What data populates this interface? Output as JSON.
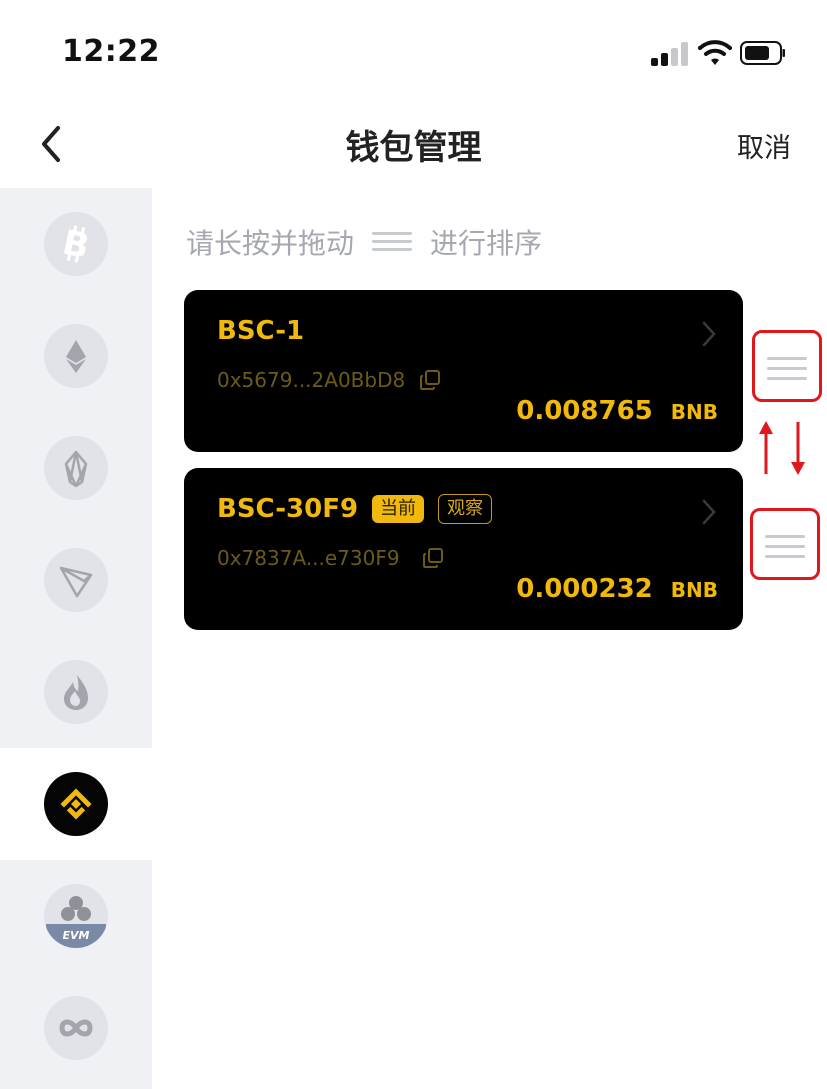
{
  "status_bar": {
    "time": "12:22"
  },
  "header": {
    "title": "钱包管理",
    "cancel_label": "取消"
  },
  "sidebar": {
    "items": [
      {
        "name": "bitcoin",
        "icon": "bitcoin-icon",
        "active": false
      },
      {
        "name": "ethereum",
        "icon": "ethereum-icon",
        "active": false
      },
      {
        "name": "eos",
        "icon": "eos-icon",
        "active": false
      },
      {
        "name": "tron",
        "icon": "tron-icon",
        "active": false
      },
      {
        "name": "heco",
        "icon": "flame-icon",
        "active": false
      },
      {
        "name": "bsc",
        "icon": "binance-icon",
        "active": true
      },
      {
        "name": "evm",
        "icon": "evm-icon",
        "label": "EVM",
        "active": false
      },
      {
        "name": "infinity",
        "icon": "infinity-icon",
        "active": false
      }
    ]
  },
  "hint": {
    "before": "请长按并拖动",
    "after": "进行排序"
  },
  "wallets": [
    {
      "name": "BSC-1",
      "address": "0x5679...2A0BbD8",
      "amount": "0.008765",
      "unit": "BNB",
      "badges": []
    },
    {
      "name": "BSC-30F9",
      "address": "0x7837A...e730F9",
      "amount": "0.000232",
      "unit": "BNB",
      "badges": [
        "当前",
        "观察"
      ]
    }
  ],
  "colors": {
    "accent": "#f0b90b",
    "card": "#000000",
    "highlight": "#e0181c",
    "sidebar_bg": "#f0f1f5"
  }
}
